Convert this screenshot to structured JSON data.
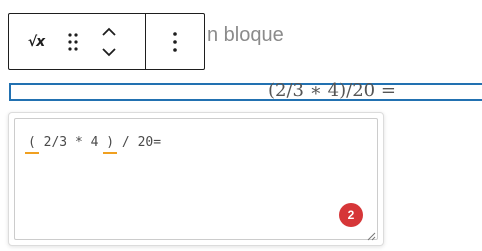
{
  "toolbar": {
    "buttons": [
      {
        "name": "formula",
        "icon": "sqrt-x-icon",
        "glyph": "√x"
      },
      {
        "name": "drag",
        "icon": "drag-handle-icon"
      },
      {
        "name": "move-up",
        "icon": "chevron-up-icon"
      },
      {
        "name": "move-down",
        "icon": "chevron-down-icon"
      },
      {
        "name": "options",
        "icon": "more-vertical-icon"
      }
    ]
  },
  "placeholder": {
    "text": "n bloque"
  },
  "math_block": {
    "rendered": "(2/3 ∗ 4)/20 ="
  },
  "editor": {
    "tokens": [
      "(",
      " 2/3 * 4 ",
      ")",
      " / 20="
    ],
    "error_count": "2"
  },
  "colors": {
    "selection_border": "#2271b1",
    "error_badge": "#d63638",
    "paren_underline": "#f0a020"
  }
}
